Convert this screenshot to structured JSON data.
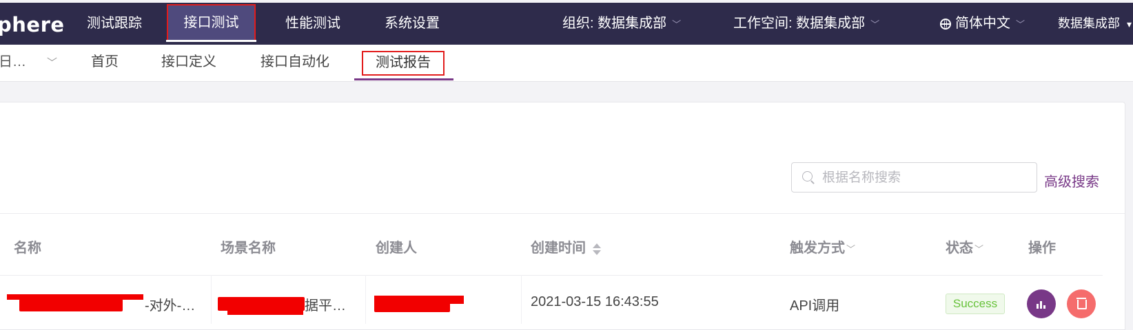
{
  "topbar": {
    "logo": "phere",
    "nav": [
      {
        "label": "测试跟踪"
      },
      {
        "label": "接口测试"
      },
      {
        "label": "性能测试"
      },
      {
        "label": "系统设置"
      }
    ],
    "org_label": "组织: 数据集成部",
    "workspace_label": "工作空间: 数据集成部",
    "language_label": "简体中文",
    "user_label": "数据集成部"
  },
  "subnav": {
    "project": "日…",
    "items": [
      {
        "label": "首页"
      },
      {
        "label": "接口定义"
      },
      {
        "label": "接口自动化"
      },
      {
        "label": "测试报告"
      }
    ]
  },
  "search": {
    "placeholder": "根据名称搜索",
    "advanced_label": "高级搜索"
  },
  "table": {
    "headers": {
      "name": "名称",
      "scenario": "场景名称",
      "creator": "创建人",
      "created_at": "创建时间",
      "trigger": "触发方式",
      "status": "状态",
      "actions": "操作"
    },
    "rows": [
      {
        "name_visible": "-对外-…",
        "scenario_visible": "据平…",
        "creator_visible": "",
        "created_at": "2021-03-15 16:43:55",
        "trigger": "API调用",
        "status": "Success"
      }
    ]
  },
  "colors": {
    "navbar_bg": "#2e2b4b",
    "accent": "#783887",
    "highlight_box": "#e21c1c",
    "success": "#67c23a",
    "danger": "#f56c6c"
  },
  "icons": [
    "chevron-down-icon",
    "globe-icon",
    "caret-down-icon",
    "search-icon",
    "sort-icon",
    "bar-chart-icon",
    "trash-icon"
  ]
}
